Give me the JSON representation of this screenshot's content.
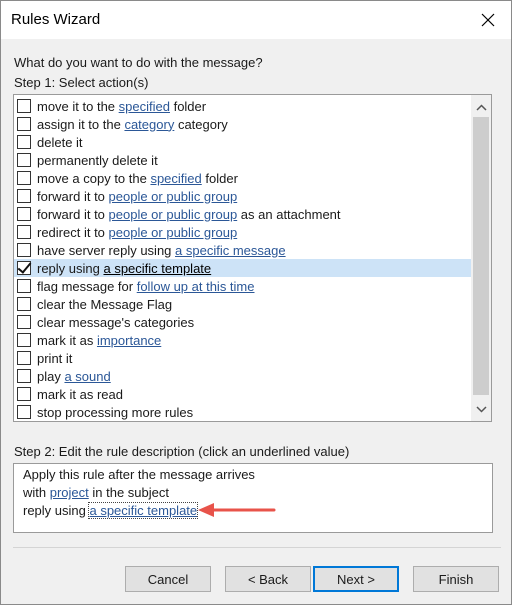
{
  "window": {
    "title": "Rules Wizard"
  },
  "prompt": "What do you want to do with the message?",
  "step1_label": "Step 1: Select action(s)",
  "actions": [
    {
      "parts": [
        {
          "t": "move it to the "
        },
        {
          "t": "specified",
          "link": true
        },
        {
          "t": " folder"
        }
      ],
      "checked": false
    },
    {
      "parts": [
        {
          "t": "assign it to the "
        },
        {
          "t": "category",
          "link": true
        },
        {
          "t": " category"
        }
      ],
      "checked": false
    },
    {
      "parts": [
        {
          "t": "delete it"
        }
      ],
      "checked": false
    },
    {
      "parts": [
        {
          "t": "permanently delete it"
        }
      ],
      "checked": false
    },
    {
      "parts": [
        {
          "t": "move a copy to the "
        },
        {
          "t": "specified",
          "link": true
        },
        {
          "t": " folder"
        }
      ],
      "checked": false
    },
    {
      "parts": [
        {
          "t": "forward it to "
        },
        {
          "t": "people or public group",
          "link": true
        }
      ],
      "checked": false
    },
    {
      "parts": [
        {
          "t": "forward it to "
        },
        {
          "t": "people or public group",
          "link": true
        },
        {
          "t": " as an attachment"
        }
      ],
      "checked": false
    },
    {
      "parts": [
        {
          "t": "redirect it to "
        },
        {
          "t": "people or public group",
          "link": true
        }
      ],
      "checked": false
    },
    {
      "parts": [
        {
          "t": "have server reply using "
        },
        {
          "t": "a specific message",
          "link": true
        }
      ],
      "checked": false
    },
    {
      "parts": [
        {
          "t": "reply using "
        },
        {
          "t": "a specific template",
          "link": true
        }
      ],
      "checked": true,
      "selected": true
    },
    {
      "parts": [
        {
          "t": "flag message for "
        },
        {
          "t": "follow up at this time",
          "link": true
        }
      ],
      "checked": false
    },
    {
      "parts": [
        {
          "t": "clear the Message Flag"
        }
      ],
      "checked": false
    },
    {
      "parts": [
        {
          "t": "clear message's categories"
        }
      ],
      "checked": false
    },
    {
      "parts": [
        {
          "t": "mark it as "
        },
        {
          "t": "importance",
          "link": true
        }
      ],
      "checked": false
    },
    {
      "parts": [
        {
          "t": "print it"
        }
      ],
      "checked": false
    },
    {
      "parts": [
        {
          "t": "play "
        },
        {
          "t": "a sound",
          "link": true
        }
      ],
      "checked": false
    },
    {
      "parts": [
        {
          "t": "mark it as read"
        }
      ],
      "checked": false
    },
    {
      "parts": [
        {
          "t": "stop processing more rules"
        }
      ],
      "checked": false
    }
  ],
  "step2_label": "Step 2: Edit the rule description (click an underlined value)",
  "description": {
    "line1": "Apply this rule after the message arrives",
    "line2_prefix": "with ",
    "line2_link": "project",
    "line2_suffix": " in the subject",
    "line3_prefix": "reply using ",
    "line3_link": "a specific template"
  },
  "buttons": {
    "cancel": "Cancel",
    "back": "< Back",
    "next": "Next >",
    "finish": "Finish"
  },
  "colors": {
    "accent": "#0078d7",
    "link": "#2b5797",
    "selection": "#cde3f7",
    "annotation_arrow": "#e8534a"
  },
  "icons": {
    "close": "close-icon",
    "scroll_up": "chevron-up-icon",
    "scroll_down": "chevron-down-icon",
    "check": "checkmark-icon"
  }
}
